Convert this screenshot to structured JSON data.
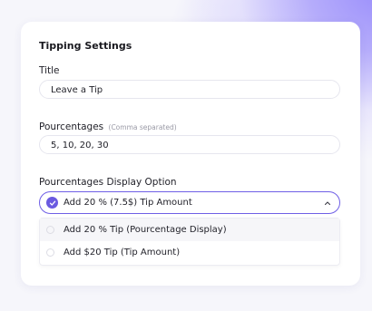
{
  "card": {
    "title": "Tipping Settings",
    "title_field": {
      "label": "Title",
      "value": "Leave a Tip"
    },
    "percentages_field": {
      "label": "Pourcentages",
      "hint": "(Comma separated)",
      "value": "5, 10, 20, 30"
    },
    "display_option": {
      "label": "Pourcentages Display Option",
      "selected": "Add 20 % (7.5$) Tip Amount",
      "options": [
        {
          "label": "Add 20 % Tip (Pourcentage Display)"
        },
        {
          "label": "Add $20 Tip (Tip Amount)"
        }
      ]
    }
  },
  "colors": {
    "accent": "#6a5ae0",
    "background_glow": "#9b8ffb"
  },
  "icons": {
    "selected": "check-icon",
    "dropdown": "chevron-up-icon",
    "option": "radio-icon"
  }
}
